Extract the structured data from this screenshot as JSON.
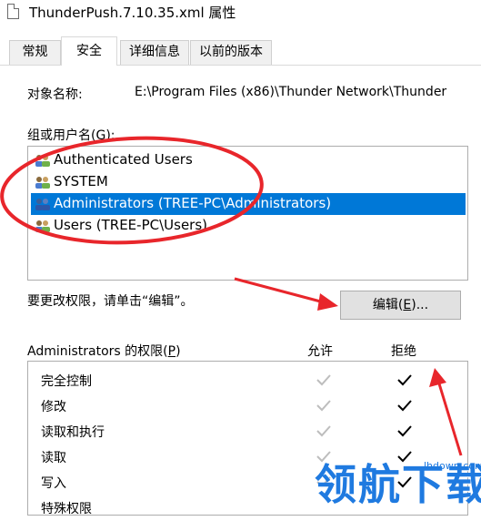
{
  "window": {
    "title": "ThunderPush.7.10.35.xml 属性"
  },
  "tabs": [
    {
      "label": "常规",
      "active": false
    },
    {
      "label": "安全",
      "active": true
    },
    {
      "label": "详细信息",
      "active": false
    },
    {
      "label": "以前的版本",
      "active": false
    }
  ],
  "object": {
    "label": "对象名称:",
    "value": "E:\\Program Files (x86)\\Thunder Network\\Thunder"
  },
  "groups": {
    "label_prefix": "组或用户名(",
    "label_key": "G",
    "label_suffix": "):",
    "items": [
      {
        "name": "Authenticated Users",
        "selected": false
      },
      {
        "name": "SYSTEM",
        "selected": false
      },
      {
        "name": "Administrators (TREE-PC\\Administrators)",
        "selected": true
      },
      {
        "name": "Users (TREE-PC\\Users)",
        "selected": false
      }
    ]
  },
  "change_hint": "要更改权限，请单击“编辑”。",
  "edit_button": {
    "prefix": "编辑(",
    "key": "E",
    "suffix": ")..."
  },
  "permissions": {
    "title_prefix": "Administrators 的权限(",
    "title_key": "P",
    "title_suffix": ")",
    "allow_header": "允许",
    "deny_header": "拒绝",
    "rows": [
      {
        "name": "完全控制",
        "allow": "inherited",
        "deny": "checked"
      },
      {
        "name": "修改",
        "allow": "inherited",
        "deny": "checked"
      },
      {
        "name": "读取和执行",
        "allow": "inherited",
        "deny": "checked"
      },
      {
        "name": "读取",
        "allow": "inherited",
        "deny": "checked"
      },
      {
        "name": "写入",
        "allow": "inherited",
        "deny": "checked"
      },
      {
        "name": "特殊权限",
        "allow": "",
        "deny": ""
      }
    ]
  },
  "watermark": {
    "text": "领航下载",
    "site": "lhdown.com",
    "color": "#1f7ae0"
  },
  "colors": {
    "selection": "#0078d7",
    "annotation": "#e8262b",
    "check_inherited": "#bdbdbd"
  },
  "icons": {
    "user_group": "user-group-icon",
    "check": "check-icon",
    "document": "document-icon"
  }
}
